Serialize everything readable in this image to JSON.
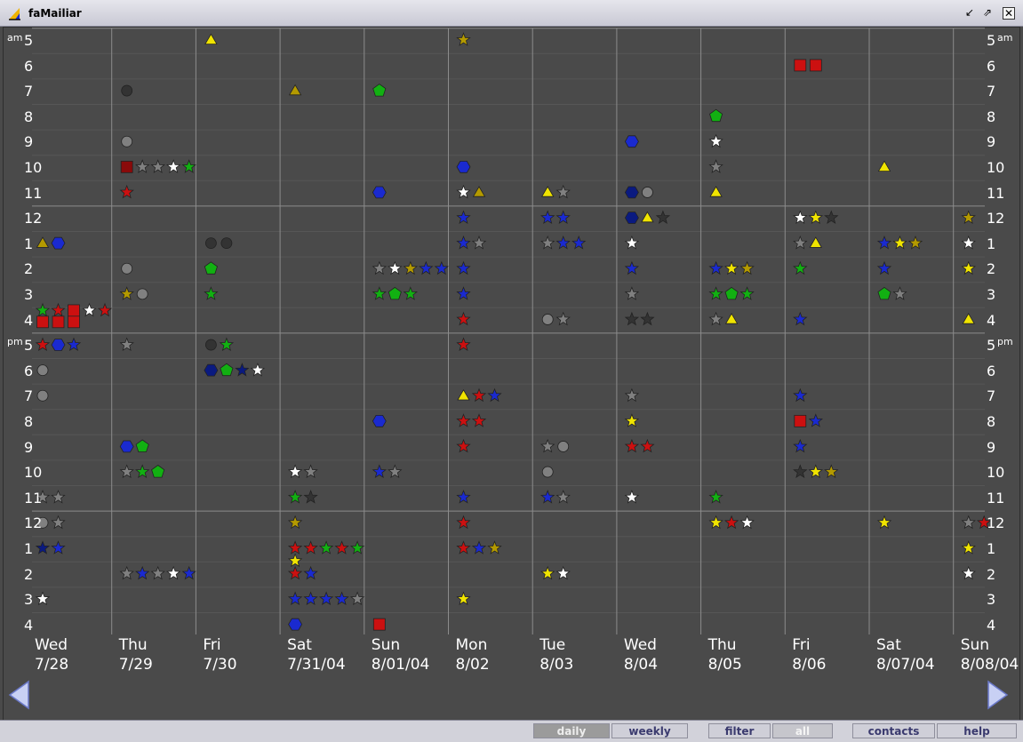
{
  "window": {
    "title": "faMailiar"
  },
  "calendar": {
    "days": [
      {
        "dow": "Wed",
        "date": "7/28"
      },
      {
        "dow": "Thu",
        "date": "7/29"
      },
      {
        "dow": "Fri",
        "date": "7/30"
      },
      {
        "dow": "Sat",
        "date": "7/31/04"
      },
      {
        "dow": "Sun",
        "date": "8/01/04"
      },
      {
        "dow": "Mon",
        "date": "8/02"
      },
      {
        "dow": "Tue",
        "date": "8/03"
      },
      {
        "dow": "Wed",
        "date": "8/04"
      },
      {
        "dow": "Thu",
        "date": "8/05"
      },
      {
        "dow": "Fri",
        "date": "8/06"
      },
      {
        "dow": "Sat",
        "date": "8/07/04"
      },
      {
        "dow": "Sun",
        "date": "8/08/04"
      }
    ],
    "hours": [
      "5",
      "6",
      "7",
      "8",
      "9",
      "10",
      "11",
      "12",
      "1",
      "2",
      "3",
      "4",
      "5",
      "6",
      "7",
      "8",
      "9",
      "10",
      "11",
      "12",
      "1",
      "2",
      "3",
      "4"
    ],
    "am_label": "am",
    "pm_label": "pm",
    "colors": {
      "red": "#cc1010",
      "blue": "#1a2ad0",
      "navy": "#0a1a80",
      "green": "#12b012",
      "yellow": "#f0e400",
      "olive": "#b49a00",
      "gray": "#808080",
      "dark": "#333333",
      "white": "#ffffff",
      "maroon": "#8a0a0a"
    },
    "marks": [
      [
        0,
        7.75,
        "triangle",
        "olive"
      ],
      [
        0,
        7.75,
        "hexagon",
        "blue"
      ],
      [
        0,
        10.4,
        "star",
        "green"
      ],
      [
        0,
        10.4,
        "star",
        "red"
      ],
      [
        0,
        10.4,
        "square",
        "red"
      ],
      [
        0,
        10.4,
        "star",
        "white"
      ],
      [
        0,
        10.4,
        "star",
        "red"
      ],
      [
        0,
        10.85,
        "square",
        "red"
      ],
      [
        0,
        10.85,
        "square",
        "red"
      ],
      [
        0,
        10.85,
        "square",
        "red"
      ],
      [
        0,
        11.75,
        "star",
        "red"
      ],
      [
        0,
        11.75,
        "hexagon",
        "blue"
      ],
      [
        0,
        11.75,
        "star",
        "blue"
      ],
      [
        0,
        12.75,
        "circle",
        "gray"
      ],
      [
        0,
        13.75,
        "circle",
        "gray"
      ],
      [
        0,
        17.75,
        "star",
        "gray"
      ],
      [
        0,
        17.75,
        "star",
        "gray"
      ],
      [
        0,
        18.75,
        "circle",
        "gray"
      ],
      [
        0,
        18.75,
        "star",
        "gray"
      ],
      [
        0,
        19.75,
        "star",
        "navy"
      ],
      [
        0,
        19.75,
        "star",
        "blue"
      ],
      [
        0,
        21.75,
        "star",
        "white"
      ],
      [
        1,
        1.75,
        "circle",
        "dark"
      ],
      [
        1,
        3.75,
        "circle",
        "gray"
      ],
      [
        1,
        4.75,
        "square",
        "maroon"
      ],
      [
        1,
        4.75,
        "star",
        "gray"
      ],
      [
        1,
        4.75,
        "star",
        "gray"
      ],
      [
        1,
        4.75,
        "star",
        "white"
      ],
      [
        1,
        4.75,
        "star",
        "green"
      ],
      [
        1,
        5.75,
        "star",
        "red"
      ],
      [
        1,
        8.75,
        "circle",
        "gray"
      ],
      [
        1,
        9.75,
        "star",
        "olive"
      ],
      [
        1,
        9.75,
        "circle",
        "gray"
      ],
      [
        1,
        11.75,
        "star",
        "gray"
      ],
      [
        1,
        15.75,
        "hexagon",
        "blue"
      ],
      [
        1,
        15.75,
        "pentagon",
        "green"
      ],
      [
        1,
        16.75,
        "star",
        "gray"
      ],
      [
        1,
        16.75,
        "star",
        "green"
      ],
      [
        1,
        16.75,
        "pentagon",
        "green"
      ],
      [
        1,
        20.75,
        "star",
        "gray"
      ],
      [
        1,
        20.75,
        "star",
        "blue"
      ],
      [
        1,
        20.75,
        "star",
        "gray"
      ],
      [
        1,
        20.75,
        "star",
        "white"
      ],
      [
        1,
        20.75,
        "star",
        "blue"
      ],
      [
        2,
        -0.25,
        "triangle",
        "yellow"
      ],
      [
        2,
        7.75,
        "circle",
        "dark"
      ],
      [
        2,
        7.75,
        "circle",
        "dark"
      ],
      [
        2,
        8.75,
        "pentagon",
        "green"
      ],
      [
        2,
        9.75,
        "star",
        "green"
      ],
      [
        2,
        11.75,
        "circle",
        "dark"
      ],
      [
        2,
        11.75,
        "star",
        "green"
      ],
      [
        2,
        12.75,
        "hexagon",
        "navy"
      ],
      [
        2,
        12.75,
        "pentagon",
        "green"
      ],
      [
        2,
        12.75,
        "star",
        "navy"
      ],
      [
        2,
        12.75,
        "star",
        "white"
      ],
      [
        3,
        1.75,
        "triangle",
        "olive"
      ],
      [
        3,
        16.75,
        "star",
        "white"
      ],
      [
        3,
        16.75,
        "star",
        "gray"
      ],
      [
        3,
        17.75,
        "star",
        "green"
      ],
      [
        3,
        17.75,
        "star",
        "dark"
      ],
      [
        3,
        18.75,
        "star",
        "olive"
      ],
      [
        3,
        19.75,
        "star",
        "red"
      ],
      [
        3,
        19.75,
        "star",
        "red"
      ],
      [
        3,
        19.75,
        "star",
        "green"
      ],
      [
        3,
        19.75,
        "star",
        "red"
      ],
      [
        3,
        19.75,
        "star",
        "green"
      ],
      [
        3,
        20.25,
        "star",
        "yellow"
      ],
      [
        3,
        20.75,
        "star",
        "red"
      ],
      [
        3,
        20.75,
        "star",
        "blue"
      ],
      [
        3,
        21.75,
        "star",
        "blue"
      ],
      [
        3,
        21.75,
        "star",
        "blue"
      ],
      [
        3,
        21.75,
        "star",
        "blue"
      ],
      [
        3,
        21.75,
        "star",
        "blue"
      ],
      [
        3,
        21.75,
        "star",
        "gray"
      ],
      [
        3,
        22.75,
        "hexagon",
        "blue"
      ],
      [
        4,
        1.75,
        "pentagon",
        "green"
      ],
      [
        4,
        5.75,
        "hexagon",
        "blue"
      ],
      [
        4,
        8.75,
        "star",
        "gray"
      ],
      [
        4,
        8.75,
        "star",
        "white"
      ],
      [
        4,
        8.75,
        "star",
        "olive"
      ],
      [
        4,
        8.75,
        "star",
        "blue"
      ],
      [
        4,
        8.75,
        "star",
        "blue"
      ],
      [
        4,
        9.75,
        "star",
        "green"
      ],
      [
        4,
        9.75,
        "pentagon",
        "green"
      ],
      [
        4,
        9.75,
        "star",
        "green"
      ],
      [
        4,
        14.75,
        "hexagon",
        "blue"
      ],
      [
        4,
        16.75,
        "star",
        "blue"
      ],
      [
        4,
        16.75,
        "star",
        "gray"
      ],
      [
        4,
        22.75,
        "square",
        "red"
      ],
      [
        5,
        -0.25,
        "star",
        "olive"
      ],
      [
        5,
        4.75,
        "hexagon",
        "blue"
      ],
      [
        5,
        5.75,
        "star",
        "white"
      ],
      [
        5,
        5.75,
        "triangle",
        "olive"
      ],
      [
        5,
        6.75,
        "star",
        "blue"
      ],
      [
        5,
        7.75,
        "star",
        "blue"
      ],
      [
        5,
        7.75,
        "star",
        "gray"
      ],
      [
        5,
        8.75,
        "star",
        "blue"
      ],
      [
        5,
        9.75,
        "star",
        "blue"
      ],
      [
        5,
        10.75,
        "star",
        "red"
      ],
      [
        5,
        11.75,
        "star",
        "red"
      ],
      [
        5,
        13.75,
        "triangle",
        "yellow"
      ],
      [
        5,
        13.75,
        "star",
        "red"
      ],
      [
        5,
        13.75,
        "star",
        "blue"
      ],
      [
        5,
        14.75,
        "star",
        "red"
      ],
      [
        5,
        14.75,
        "star",
        "red"
      ],
      [
        5,
        15.75,
        "star",
        "red"
      ],
      [
        5,
        17.75,
        "star",
        "blue"
      ],
      [
        5,
        18.75,
        "star",
        "red"
      ],
      [
        5,
        19.75,
        "star",
        "red"
      ],
      [
        5,
        19.75,
        "star",
        "blue"
      ],
      [
        5,
        19.75,
        "star",
        "olive"
      ],
      [
        5,
        21.75,
        "star",
        "yellow"
      ],
      [
        6,
        5.75,
        "triangle",
        "yellow"
      ],
      [
        6,
        5.75,
        "star",
        "gray"
      ],
      [
        6,
        6.75,
        "star",
        "blue"
      ],
      [
        6,
        6.75,
        "star",
        "blue"
      ],
      [
        6,
        7.75,
        "star",
        "gray"
      ],
      [
        6,
        7.75,
        "star",
        "blue"
      ],
      [
        6,
        7.75,
        "star",
        "blue"
      ],
      [
        6,
        10.75,
        "circle",
        "gray"
      ],
      [
        6,
        10.75,
        "star",
        "gray"
      ],
      [
        6,
        15.75,
        "star",
        "gray"
      ],
      [
        6,
        15.75,
        "circle",
        "gray"
      ],
      [
        6,
        16.75,
        "circle",
        "gray"
      ],
      [
        6,
        17.75,
        "star",
        "blue"
      ],
      [
        6,
        17.75,
        "star",
        "gray"
      ],
      [
        6,
        20.75,
        "star",
        "yellow"
      ],
      [
        6,
        20.75,
        "star",
        "white"
      ],
      [
        7,
        3.75,
        "hexagon",
        "blue"
      ],
      [
        7,
        5.75,
        "hexagon",
        "navy"
      ],
      [
        7,
        5.75,
        "circle",
        "gray"
      ],
      [
        7,
        6.75,
        "hexagon",
        "navy"
      ],
      [
        7,
        6.75,
        "triangle",
        "yellow"
      ],
      [
        7,
        6.75,
        "star",
        "dark"
      ],
      [
        7,
        7.75,
        "star",
        "white"
      ],
      [
        7,
        8.75,
        "star",
        "blue"
      ],
      [
        7,
        9.75,
        "star",
        "gray"
      ],
      [
        7,
        10.75,
        "star",
        "dark"
      ],
      [
        7,
        10.75,
        "star",
        "dark"
      ],
      [
        7,
        13.75,
        "star",
        "gray"
      ],
      [
        7,
        14.75,
        "star",
        "yellow"
      ],
      [
        7,
        15.75,
        "star",
        "red"
      ],
      [
        7,
        15.75,
        "star",
        "red"
      ],
      [
        7,
        17.75,
        "star",
        "white"
      ],
      [
        8,
        2.75,
        "pentagon",
        "green"
      ],
      [
        8,
        3.75,
        "star",
        "white"
      ],
      [
        8,
        4.75,
        "star",
        "gray"
      ],
      [
        8,
        5.75,
        "triangle",
        "yellow"
      ],
      [
        8,
        8.75,
        "star",
        "blue"
      ],
      [
        8,
        8.75,
        "star",
        "yellow"
      ],
      [
        8,
        8.75,
        "star",
        "olive"
      ],
      [
        8,
        9.75,
        "star",
        "green"
      ],
      [
        8,
        9.75,
        "pentagon",
        "green"
      ],
      [
        8,
        9.75,
        "star",
        "green"
      ],
      [
        8,
        10.75,
        "star",
        "gray"
      ],
      [
        8,
        10.75,
        "triangle",
        "yellow"
      ],
      [
        8,
        17.75,
        "star",
        "green"
      ],
      [
        8,
        18.75,
        "star",
        "yellow"
      ],
      [
        8,
        18.75,
        "star",
        "red"
      ],
      [
        8,
        18.75,
        "star",
        "white"
      ],
      [
        9,
        0.75,
        "square",
        "red"
      ],
      [
        9,
        0.75,
        "square",
        "red"
      ],
      [
        9,
        6.75,
        "star",
        "white"
      ],
      [
        9,
        6.75,
        "star",
        "yellow"
      ],
      [
        9,
        6.75,
        "star",
        "dark"
      ],
      [
        9,
        7.75,
        "star",
        "gray"
      ],
      [
        9,
        7.75,
        "triangle",
        "yellow"
      ],
      [
        9,
        8.75,
        "star",
        "green"
      ],
      [
        9,
        10.75,
        "star",
        "blue"
      ],
      [
        9,
        13.75,
        "star",
        "blue"
      ],
      [
        9,
        14.75,
        "square",
        "red"
      ],
      [
        9,
        14.75,
        "star",
        "blue"
      ],
      [
        9,
        15.75,
        "star",
        "blue"
      ],
      [
        9,
        16.75,
        "star",
        "dark"
      ],
      [
        9,
        16.75,
        "star",
        "yellow"
      ],
      [
        9,
        16.75,
        "star",
        "olive"
      ],
      [
        10,
        4.75,
        "triangle",
        "yellow"
      ],
      [
        10,
        7.75,
        "star",
        "blue"
      ],
      [
        10,
        7.75,
        "star",
        "yellow"
      ],
      [
        10,
        7.75,
        "star",
        "olive"
      ],
      [
        10,
        8.75,
        "star",
        "blue"
      ],
      [
        10,
        9.75,
        "pentagon",
        "green"
      ],
      [
        10,
        9.75,
        "star",
        "gray"
      ],
      [
        10,
        18.75,
        "star",
        "yellow"
      ],
      [
        11,
        6.75,
        "star",
        "olive"
      ],
      [
        11,
        7.75,
        "star",
        "white"
      ],
      [
        11,
        8.75,
        "star",
        "yellow"
      ],
      [
        11,
        10.75,
        "triangle",
        "yellow"
      ],
      [
        11,
        18.75,
        "star",
        "gray"
      ],
      [
        11,
        18.75,
        "star",
        "red"
      ],
      [
        11,
        19.75,
        "star",
        "yellow"
      ],
      [
        11,
        20.75,
        "star",
        "white"
      ]
    ]
  },
  "nav": {
    "prev": "previous-arrow",
    "next": "next-arrow"
  },
  "tabs": {
    "daily": "daily",
    "weekly": "weekly",
    "filter": "filter",
    "all": "all",
    "contacts": "contacts",
    "help": "help"
  }
}
